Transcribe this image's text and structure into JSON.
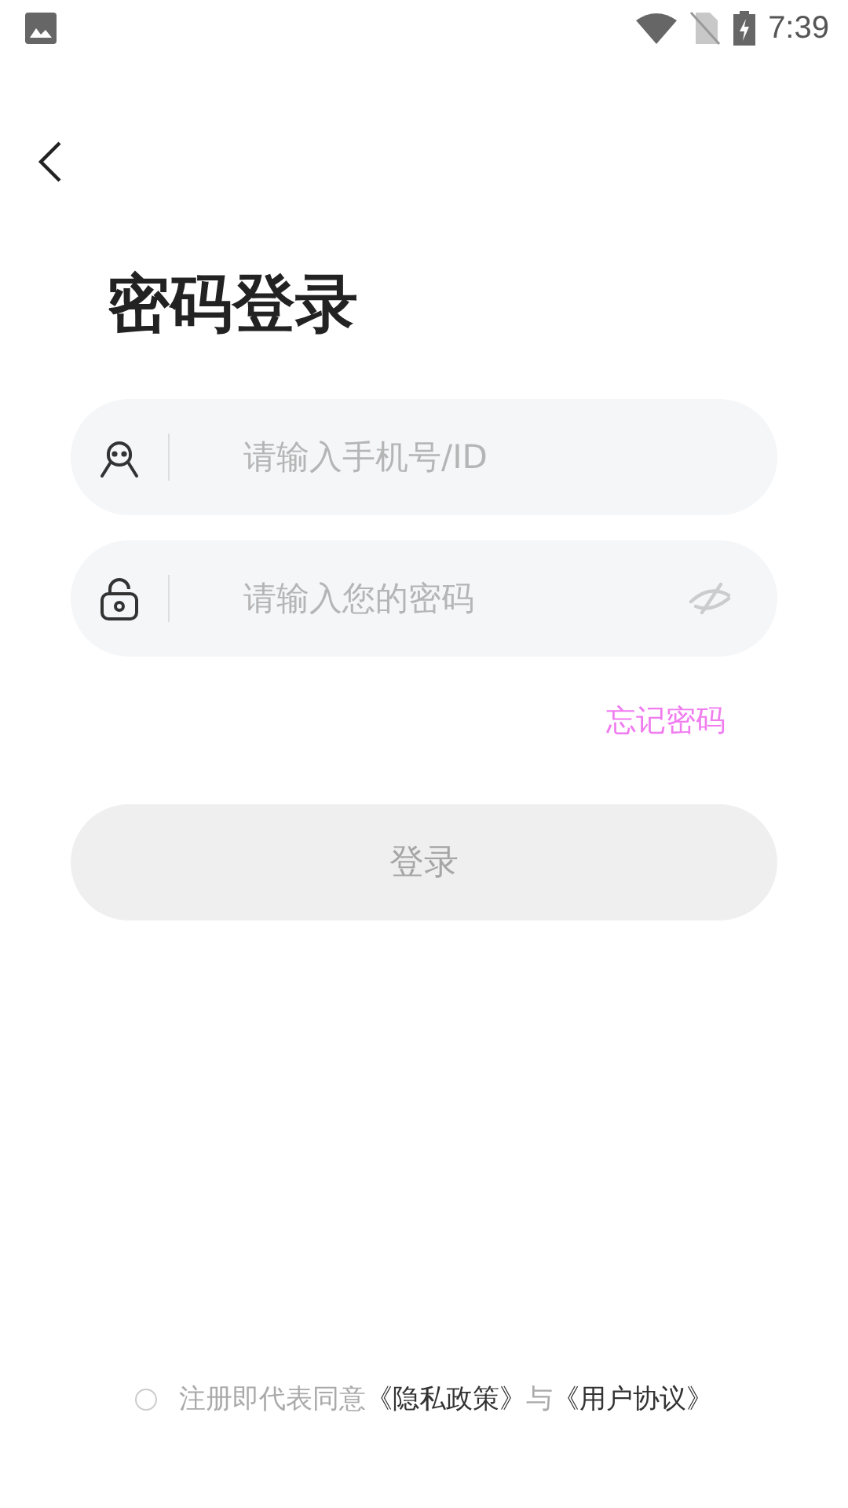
{
  "status_bar": {
    "time": "7:39"
  },
  "title": "密码登录",
  "fields": [
    {
      "kind": "account",
      "placeholder": "请输入手机号/ID"
    },
    {
      "kind": "password",
      "placeholder": "请输入您的密码",
      "visible": false
    }
  ],
  "forgot_link": "忘记密码",
  "login_button": {
    "label": "登录",
    "disabled": true
  },
  "agreement": {
    "checked": false,
    "text": "注册即代表同意",
    "privacy_link": "《隐私政策》",
    "connector": "与",
    "terms_link": "《用户协议》"
  }
}
